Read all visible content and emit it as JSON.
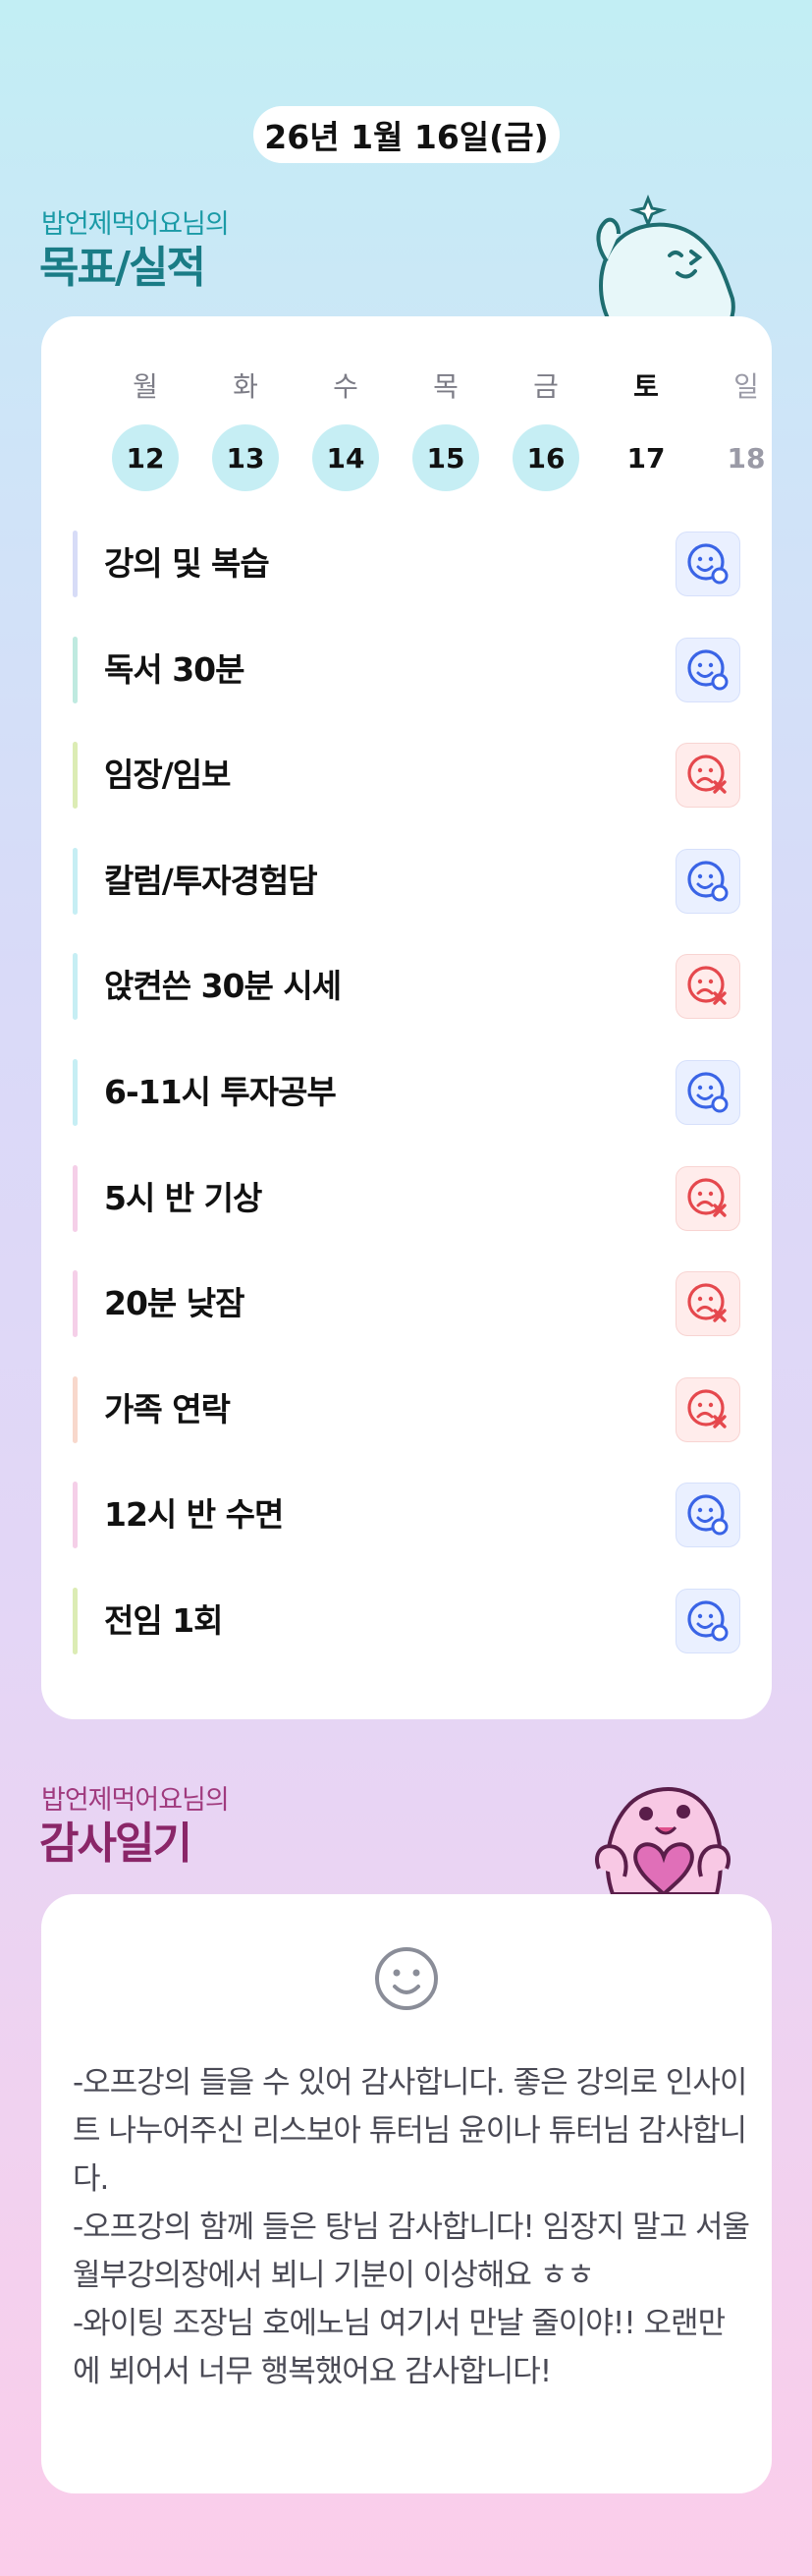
{
  "header": {
    "date": "26년 1월 16일(금)"
  },
  "goals_section": {
    "owner_label": "밥언제먹어요님의",
    "title": "목표/실적",
    "title_color": "#1a7c86",
    "owner_color": "#1a9aa6"
  },
  "week": [
    {
      "name": "월",
      "num": "12",
      "state": "done"
    },
    {
      "name": "화",
      "num": "13",
      "state": "done"
    },
    {
      "name": "수",
      "num": "14",
      "state": "done"
    },
    {
      "name": "목",
      "num": "15",
      "state": "done"
    },
    {
      "name": "금",
      "num": "16",
      "state": "done"
    },
    {
      "name": "토",
      "num": "17",
      "state": "today"
    },
    {
      "name": "일",
      "num": "18",
      "state": "future"
    }
  ],
  "goals": [
    {
      "label": "강의 및 복습",
      "bar_color": "#d7dcf7",
      "status": "success"
    },
    {
      "label": "독서 30분",
      "bar_color": "#bfeae0",
      "status": "success"
    },
    {
      "label": "임장/임보",
      "bar_color": "#dcecb4",
      "status": "fail"
    },
    {
      "label": "칼럼/투자경험담",
      "bar_color": "#c6eef4",
      "status": "success"
    },
    {
      "label": "앉켠쓴 30분 시세",
      "bar_color": "#c6eef4",
      "status": "fail"
    },
    {
      "label": "6-11시 투자공부",
      "bar_color": "#c6eef4",
      "status": "success"
    },
    {
      "label": "5시 반 기상",
      "bar_color": "#f5cfe8",
      "status": "fail"
    },
    {
      "label": "20분 낮잠",
      "bar_color": "#f5cfe8",
      "status": "fail"
    },
    {
      "label": "가족 연락",
      "bar_color": "#f8d8cc",
      "status": "fail"
    },
    {
      "label": "12시 반 수면",
      "bar_color": "#f5cfe8",
      "status": "success"
    },
    {
      "label": "전임 1회",
      "bar_color": "#dcecb4",
      "status": "success"
    }
  ],
  "status_colors": {
    "success": "#3a64e6",
    "fail": "#e5484d"
  },
  "diary_section": {
    "owner_label": "밥언제먹어요님의",
    "title": "감사일기",
    "title_color": "#8a2668",
    "owner_color": "#a03a7e"
  },
  "diary": {
    "text": "-오프강의 들을 수 있어 감사합니다. 좋은 강의로 인사이트 나누어주신 리스보아 튜터님 윤이나 튜터님 감사합니다.\n-오프강의 함께 들은 탕님 감사합니다! 임장지 말고 서울 월부강의장에서 뵈니 기분이 이상해요 ㅎㅎ\n-와이팅 조장님 호에노님 여기서 만날 줄이야!! 오랜만에 뵈어서 너무 행복했어요 감사합니다!"
  }
}
